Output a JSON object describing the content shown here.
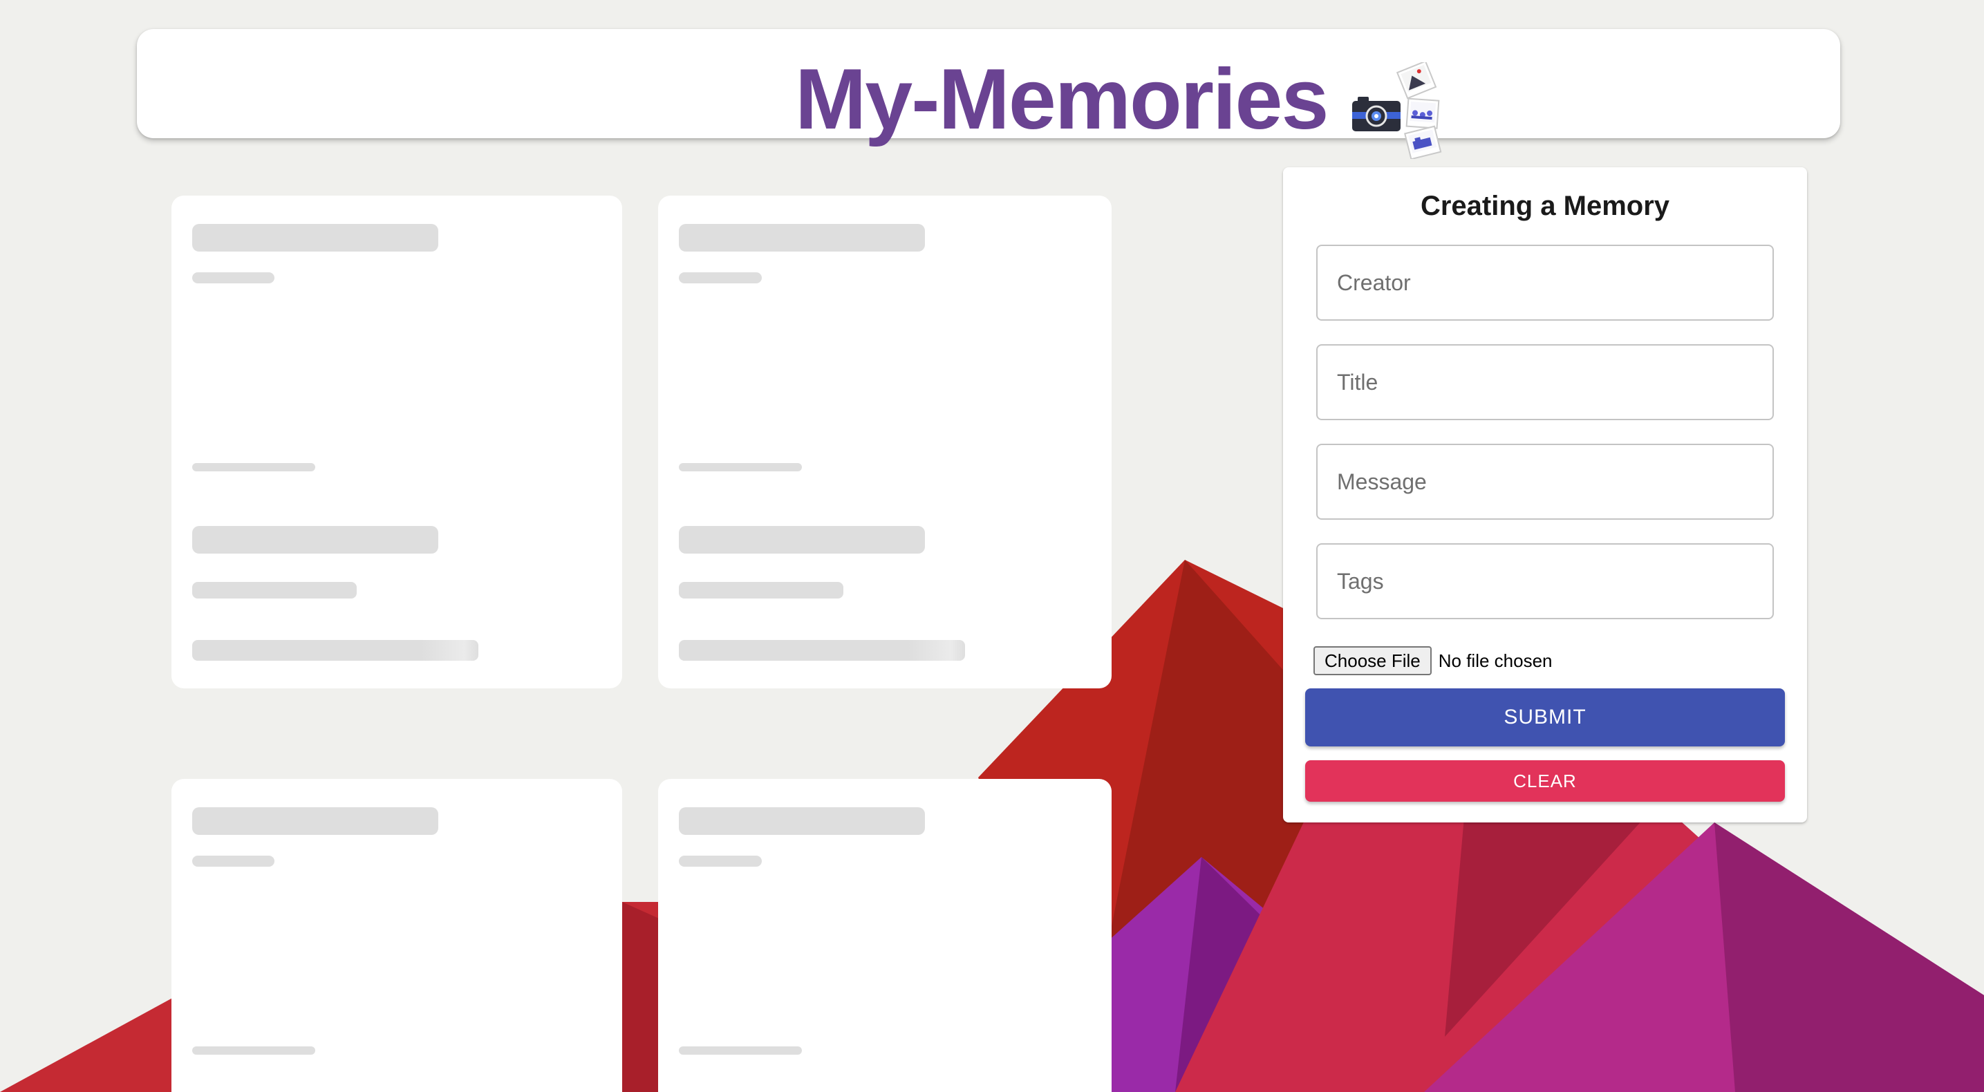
{
  "app": {
    "title": "My-Memories",
    "logo_icon": "memories-camera-photos-icon"
  },
  "memories": {
    "state": "loading",
    "placeholder_cards": 4
  },
  "form": {
    "title": "Creating a Memory",
    "fields": {
      "creator": {
        "placeholder": "Creator",
        "value": ""
      },
      "title": {
        "placeholder": "Title",
        "value": ""
      },
      "message": {
        "placeholder": "Message",
        "value": ""
      },
      "tags": {
        "placeholder": "Tags",
        "value": ""
      }
    },
    "file": {
      "button_label": "Choose File",
      "status": "No file chosen"
    },
    "submit_label": "SUBMIT",
    "clear_label": "CLEAR"
  },
  "colors": {
    "background": "#f0f0ed",
    "title": "#6a4392",
    "submit": "#4053b0",
    "clear": "#e2335a",
    "skeleton": "#dedede"
  }
}
